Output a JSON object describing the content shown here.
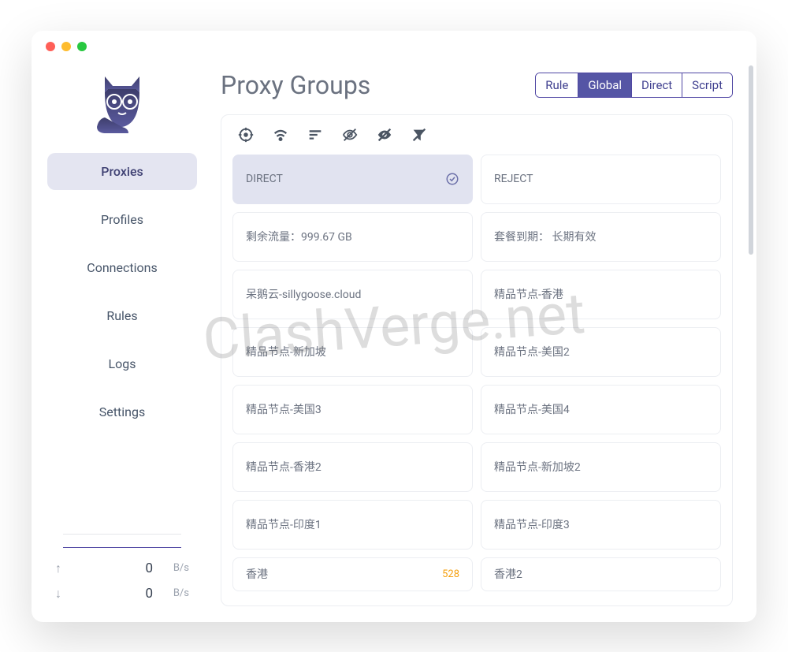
{
  "header": {
    "title": "Proxy Groups"
  },
  "mode_tabs": [
    {
      "label": "Rule",
      "active": false
    },
    {
      "label": "Global",
      "active": true
    },
    {
      "label": "Direct",
      "active": false
    },
    {
      "label": "Script",
      "active": false
    }
  ],
  "sidebar": {
    "items": [
      {
        "label": "Proxies",
        "active": true
      },
      {
        "label": "Profiles",
        "active": false
      },
      {
        "label": "Connections",
        "active": false
      },
      {
        "label": "Rules",
        "active": false
      },
      {
        "label": "Logs",
        "active": false
      },
      {
        "label": "Settings",
        "active": false
      }
    ]
  },
  "traffic": {
    "upload": {
      "value": "0",
      "unit": "B/s"
    },
    "download": {
      "value": "0",
      "unit": "B/s"
    }
  },
  "proxies": [
    {
      "label": "DIRECT",
      "selected": true
    },
    {
      "label": "REJECT"
    },
    {
      "label": "剩余流量：999.67 GB"
    },
    {
      "label": "套餐到期： 长期有效"
    },
    {
      "label": "呆鹅云-sillygoose.cloud"
    },
    {
      "label": "精品节点-香港"
    },
    {
      "label": "精品节点-新加坡"
    },
    {
      "label": "精品节点-美国2"
    },
    {
      "label": "精品节点-美国3"
    },
    {
      "label": "精品节点-美国4"
    },
    {
      "label": "精品节点-香港2"
    },
    {
      "label": "精品节点-新加坡2"
    },
    {
      "label": "精品节点-印度1"
    },
    {
      "label": "精品节点-印度3"
    },
    {
      "label": "香港",
      "latency": "528",
      "partial": true
    },
    {
      "label": "香港2",
      "partial": true
    }
  ],
  "watermark": "ClashVerge.net"
}
